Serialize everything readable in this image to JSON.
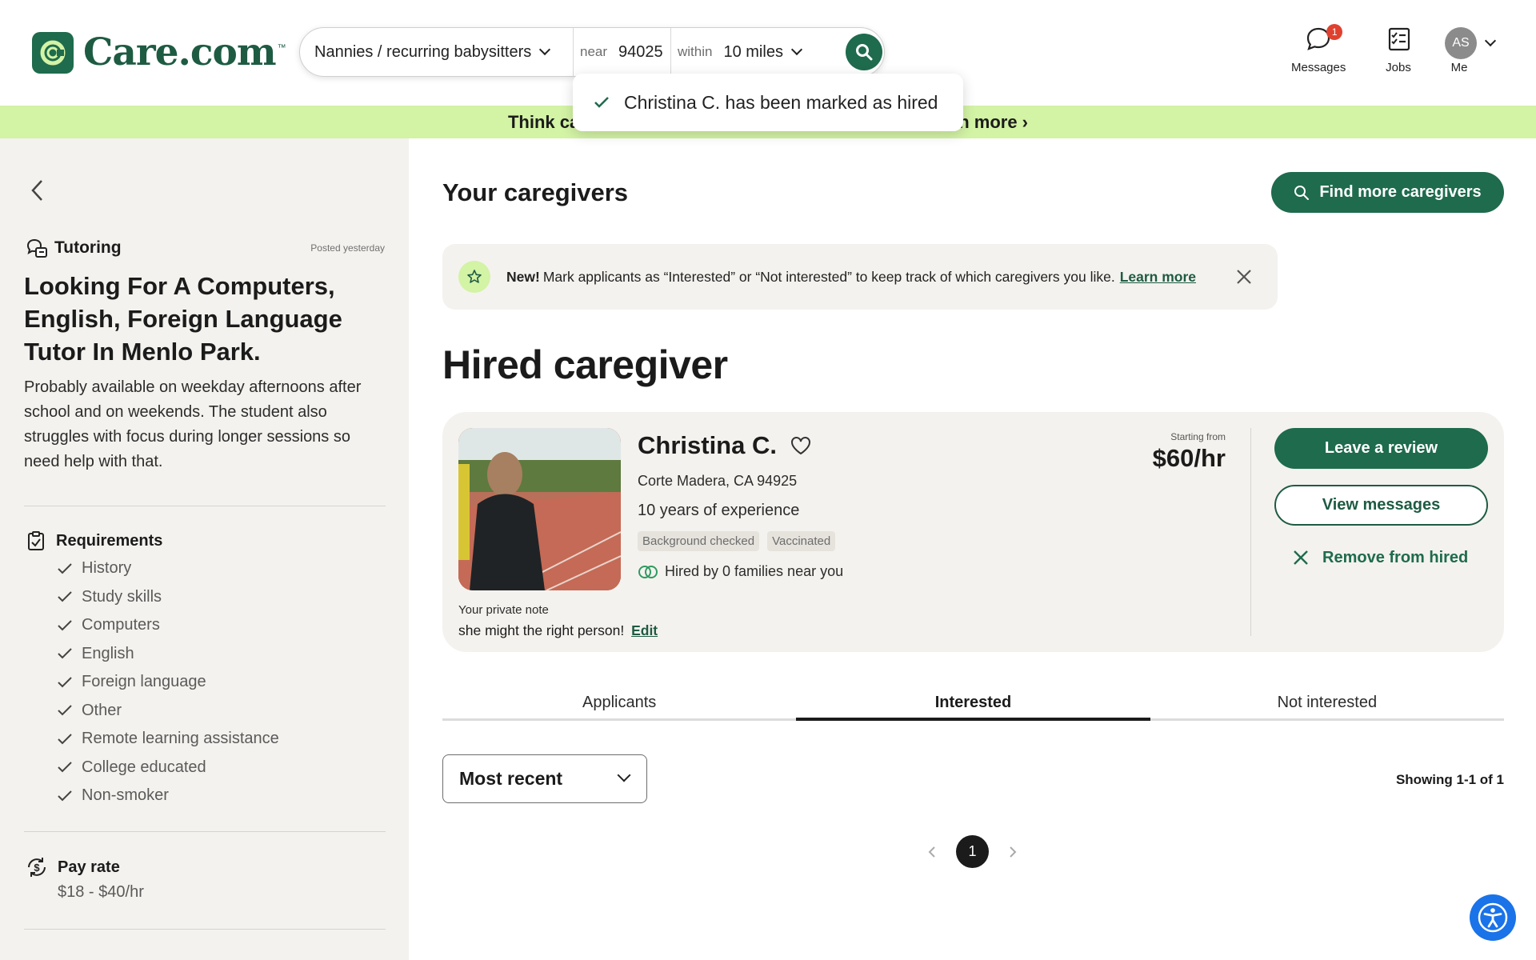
{
  "brand": {
    "name": "Care.com",
    "tm": "™",
    "color": "#1e6b4d",
    "accent": "#d3f3a5"
  },
  "search": {
    "service": "Nannies / recurring babysitters",
    "near_label": "near",
    "zip": "94025",
    "within_label": "within",
    "distance": "10 miles"
  },
  "toast": {
    "message": "Christina C. has been marked as hired"
  },
  "nav": {
    "messages": {
      "label": "Messages",
      "badge": "1"
    },
    "jobs": {
      "label": "Jobs"
    },
    "me": {
      "label": "Me",
      "initials": "AS"
    }
  },
  "promo": {
    "left_text": "Think ca",
    "right_text": "n more ›"
  },
  "sidebar": {
    "category": "Tutoring",
    "posted": "Posted yesterday",
    "title": "Looking For A Computers, English, Foreign Language Tutor In Menlo Park.",
    "description": "Probably available on weekday afternoons after school and on weekends. The student also struggles with focus during longer sessions so need help with that.",
    "requirements_title": "Requirements",
    "requirements": [
      "History",
      "Study skills",
      "Computers",
      "English",
      "Foreign language",
      "Other",
      "Remote learning assistance",
      "College educated",
      "Non-smoker"
    ],
    "pay_title": "Pay rate",
    "pay_value": "$18 - $40/hr"
  },
  "main": {
    "title": "Your caregivers",
    "find_button": "Find more caregivers",
    "notice": {
      "bold": "New!",
      "text": "Mark applicants as “Interested” or “Not interested” to keep track of which caregivers you like.",
      "link": "Learn more"
    },
    "section_title": "Hired caregiver",
    "caregiver": {
      "name": "Christina C.",
      "location": "Corte Madera, CA 94925",
      "experience": "10 years of experience",
      "tags": [
        "Background checked",
        "Vaccinated"
      ],
      "hired_by": "Hired by 0 families near you",
      "starting_label": "Starting from",
      "rate": "$60/hr",
      "note_label": "Your private note",
      "note": "she might the right person!",
      "edit": "Edit",
      "review_button": "Leave a review",
      "messages_button": "View messages",
      "remove_button": "Remove from hired"
    },
    "tabs": [
      {
        "label": "Applicants",
        "active": false
      },
      {
        "label": "Interested",
        "active": true
      },
      {
        "label": "Not interested",
        "active": false
      }
    ],
    "sort": "Most recent",
    "showing": "Showing 1-1 of 1",
    "page": "1"
  }
}
